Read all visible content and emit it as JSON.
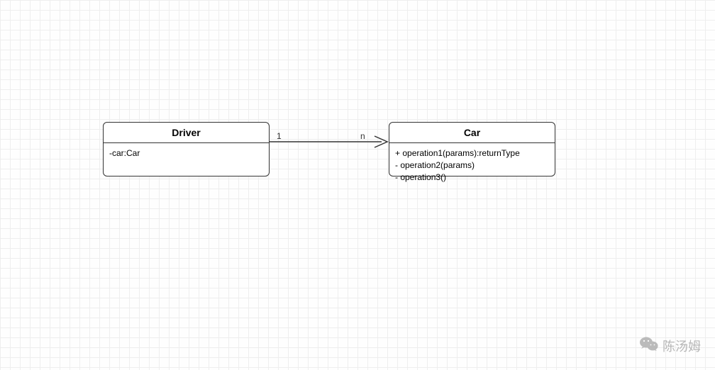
{
  "classes": {
    "driver": {
      "name": "Driver",
      "attributes": [
        "-car:Car"
      ]
    },
    "car": {
      "name": "Car",
      "operations": [
        "+ operation1(params):returnType",
        "- operation2(params)",
        "- operation3()"
      ]
    }
  },
  "association": {
    "left_multiplicity": "1",
    "right_multiplicity": "n"
  },
  "watermark": {
    "text": "陈汤姆"
  }
}
